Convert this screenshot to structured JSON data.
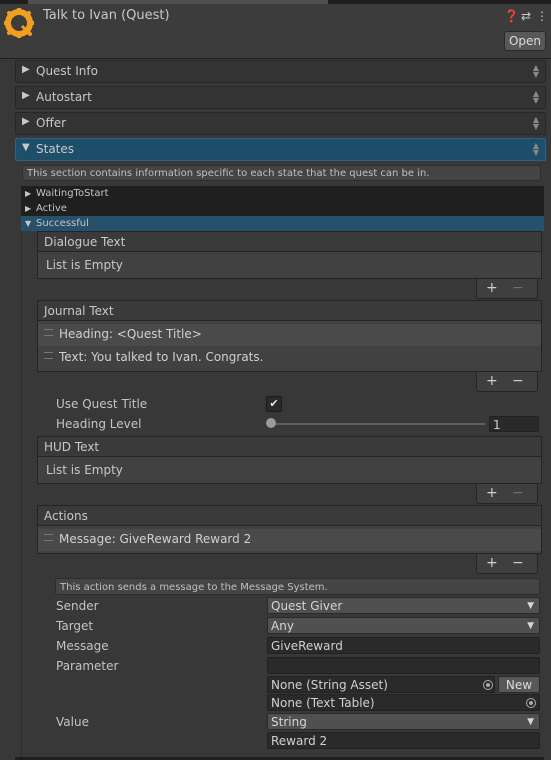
{
  "header": {
    "title": "Talk to Ivan (Quest)",
    "open_label": "Open",
    "icons": [
      "help-icon",
      "presets-icon",
      "more-icon"
    ]
  },
  "foldouts": [
    {
      "label": "Quest Info"
    },
    {
      "label": "Autostart"
    },
    {
      "label": "Offer"
    },
    {
      "label": "States"
    }
  ],
  "states": {
    "help": "This section contains information specific to each state that the quest can be in.",
    "items": [
      {
        "label": "WaitingToStart"
      },
      {
        "label": "Active"
      },
      {
        "label": "Successful"
      }
    ]
  },
  "successful": {
    "dialogue": {
      "header": "Dialogue Text",
      "empty": "List is Empty"
    },
    "journal": {
      "header": "Journal Text",
      "rows": [
        "Heading: <Quest Title>",
        "Text: You talked to Ivan. Congrats."
      ]
    },
    "use_quest_title_label": "Use Quest Title",
    "use_quest_title": true,
    "heading_level_label": "Heading Level",
    "heading_level": "1",
    "hud": {
      "header": "HUD Text",
      "empty": "List is Empty"
    },
    "actions": {
      "header": "Actions",
      "rows": [
        "Message: GiveReward  Reward 2"
      ]
    },
    "action_help": "This action sends a message to the Message System.",
    "fields": {
      "sender_label": "Sender",
      "sender": "Quest Giver",
      "target_label": "Target",
      "target": "Any",
      "message_label": "Message",
      "message": "GiveReward",
      "parameter_label": "Parameter",
      "parameter": "",
      "string_asset": "None (String Asset)",
      "new_label": "New",
      "text_table": "None (Text Table)",
      "value_label": "Value",
      "value_type": "String",
      "value": "Reward 2"
    }
  },
  "list_controls": {
    "plus": "+",
    "minus": "−"
  },
  "colors": {
    "accent": "#1d4f6b",
    "logo": "#f0a020",
    "background": "#383838"
  }
}
